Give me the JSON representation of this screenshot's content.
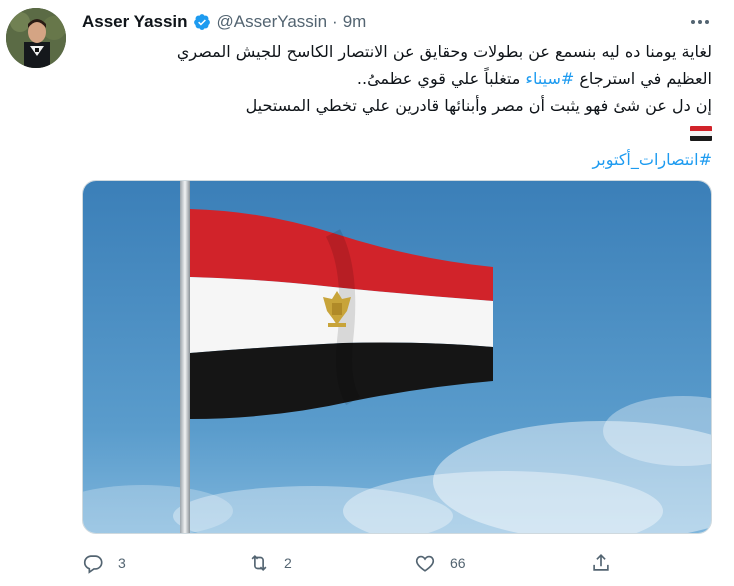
{
  "tweet": {
    "author_name": "Asser Yassin",
    "handle": "@AsserYassin",
    "separator": "·",
    "time": "9m",
    "lines": {
      "line1": "لغاية يومنا ده ليه بنسمع عن بطولات وحقايق عن الانتصار الكاسح  للجيش المصري",
      "line2_pre": "العظيم في استرجاع ",
      "line2_tag": "#سيناء",
      "line2_post": " متغلباً علي قوي عظمىُ..",
      "line3": "إن دل عن شئ فهو يثبت أن مصر وأبنائها قادرين علي تخطي المستحيل",
      "hashtag2": "#انتصارات_أكتوبر"
    },
    "flag_emoji": "egypt-flag",
    "media": {
      "description_icon": "egypt-flag-photo"
    },
    "actions": {
      "reply_count": "3",
      "retweet_count": "2",
      "like_count": "66",
      "share_count": ""
    }
  },
  "colors": {
    "accent": "#1d9bf0",
    "secondary_text": "#536471",
    "flag_red": "#d1232a",
    "flag_white": "#ffffff",
    "flag_black": "#1a1a1a",
    "sky": "#3f86c0"
  }
}
